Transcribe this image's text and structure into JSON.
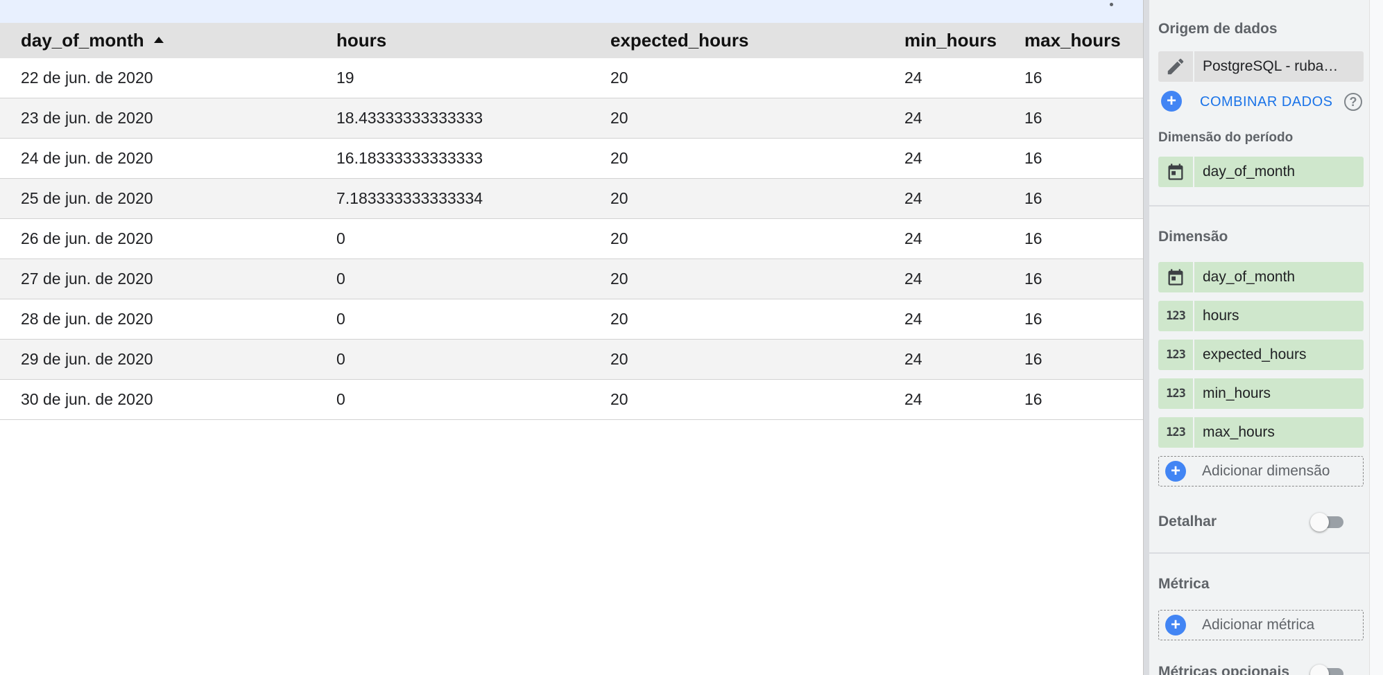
{
  "table": {
    "columns": [
      {
        "label": "day_of_month",
        "sorted": "asc"
      },
      {
        "label": "hours"
      },
      {
        "label": "expected_hours"
      },
      {
        "label": "min_hours"
      },
      {
        "label": "max_hours"
      }
    ],
    "rows": [
      [
        "22 de jun. de 2020",
        "19",
        "20",
        "24",
        "16"
      ],
      [
        "23 de jun. de 2020",
        "18.43333333333333",
        "20",
        "24",
        "16"
      ],
      [
        "24 de jun. de 2020",
        "16.18333333333333",
        "20",
        "24",
        "16"
      ],
      [
        "25 de jun. de 2020",
        "7.183333333333334",
        "20",
        "24",
        "16"
      ],
      [
        "26 de jun. de 2020",
        "0",
        "20",
        "24",
        "16"
      ],
      [
        "27 de jun. de 2020",
        "0",
        "20",
        "24",
        "16"
      ],
      [
        "28 de jun. de 2020",
        "0",
        "20",
        "24",
        "16"
      ],
      [
        "29 de jun. de 2020",
        "0",
        "20",
        "24",
        "16"
      ],
      [
        "30 de jun. de 2020",
        "0",
        "20",
        "24",
        "16"
      ]
    ]
  },
  "panel": {
    "data_source": {
      "title": "Origem de dados",
      "source_name": "PostgreSQL - ruba…",
      "blend_label": "COMBINAR DADOS",
      "help_glyph": "?"
    },
    "date_dimension": {
      "title": "Dimensão do período",
      "field": "day_of_month"
    },
    "dimension": {
      "title": "Dimensão",
      "fields": [
        {
          "icon": "calendar-icon",
          "label": "day_of_month"
        },
        {
          "icon": "number-icon",
          "glyph": "123",
          "label": "hours"
        },
        {
          "icon": "number-icon",
          "glyph": "123",
          "label": "expected_hours"
        },
        {
          "icon": "number-icon",
          "glyph": "123",
          "label": "min_hours"
        },
        {
          "icon": "number-icon",
          "glyph": "123",
          "label": "max_hours"
        }
      ],
      "add_label": "Adicionar dimensão"
    },
    "drilldown": {
      "label": "Detalhar",
      "enabled": false
    },
    "metric": {
      "title": "Métrica",
      "add_label": "Adicionar métrica"
    },
    "optional_metrics": {
      "label": "Métricas opcionais",
      "enabled": false
    }
  },
  "colors": {
    "field_chip": "#cfe7cc",
    "accent": "#4285f4",
    "link": "#1a73e8",
    "header_bg": "#e2e2e2"
  }
}
